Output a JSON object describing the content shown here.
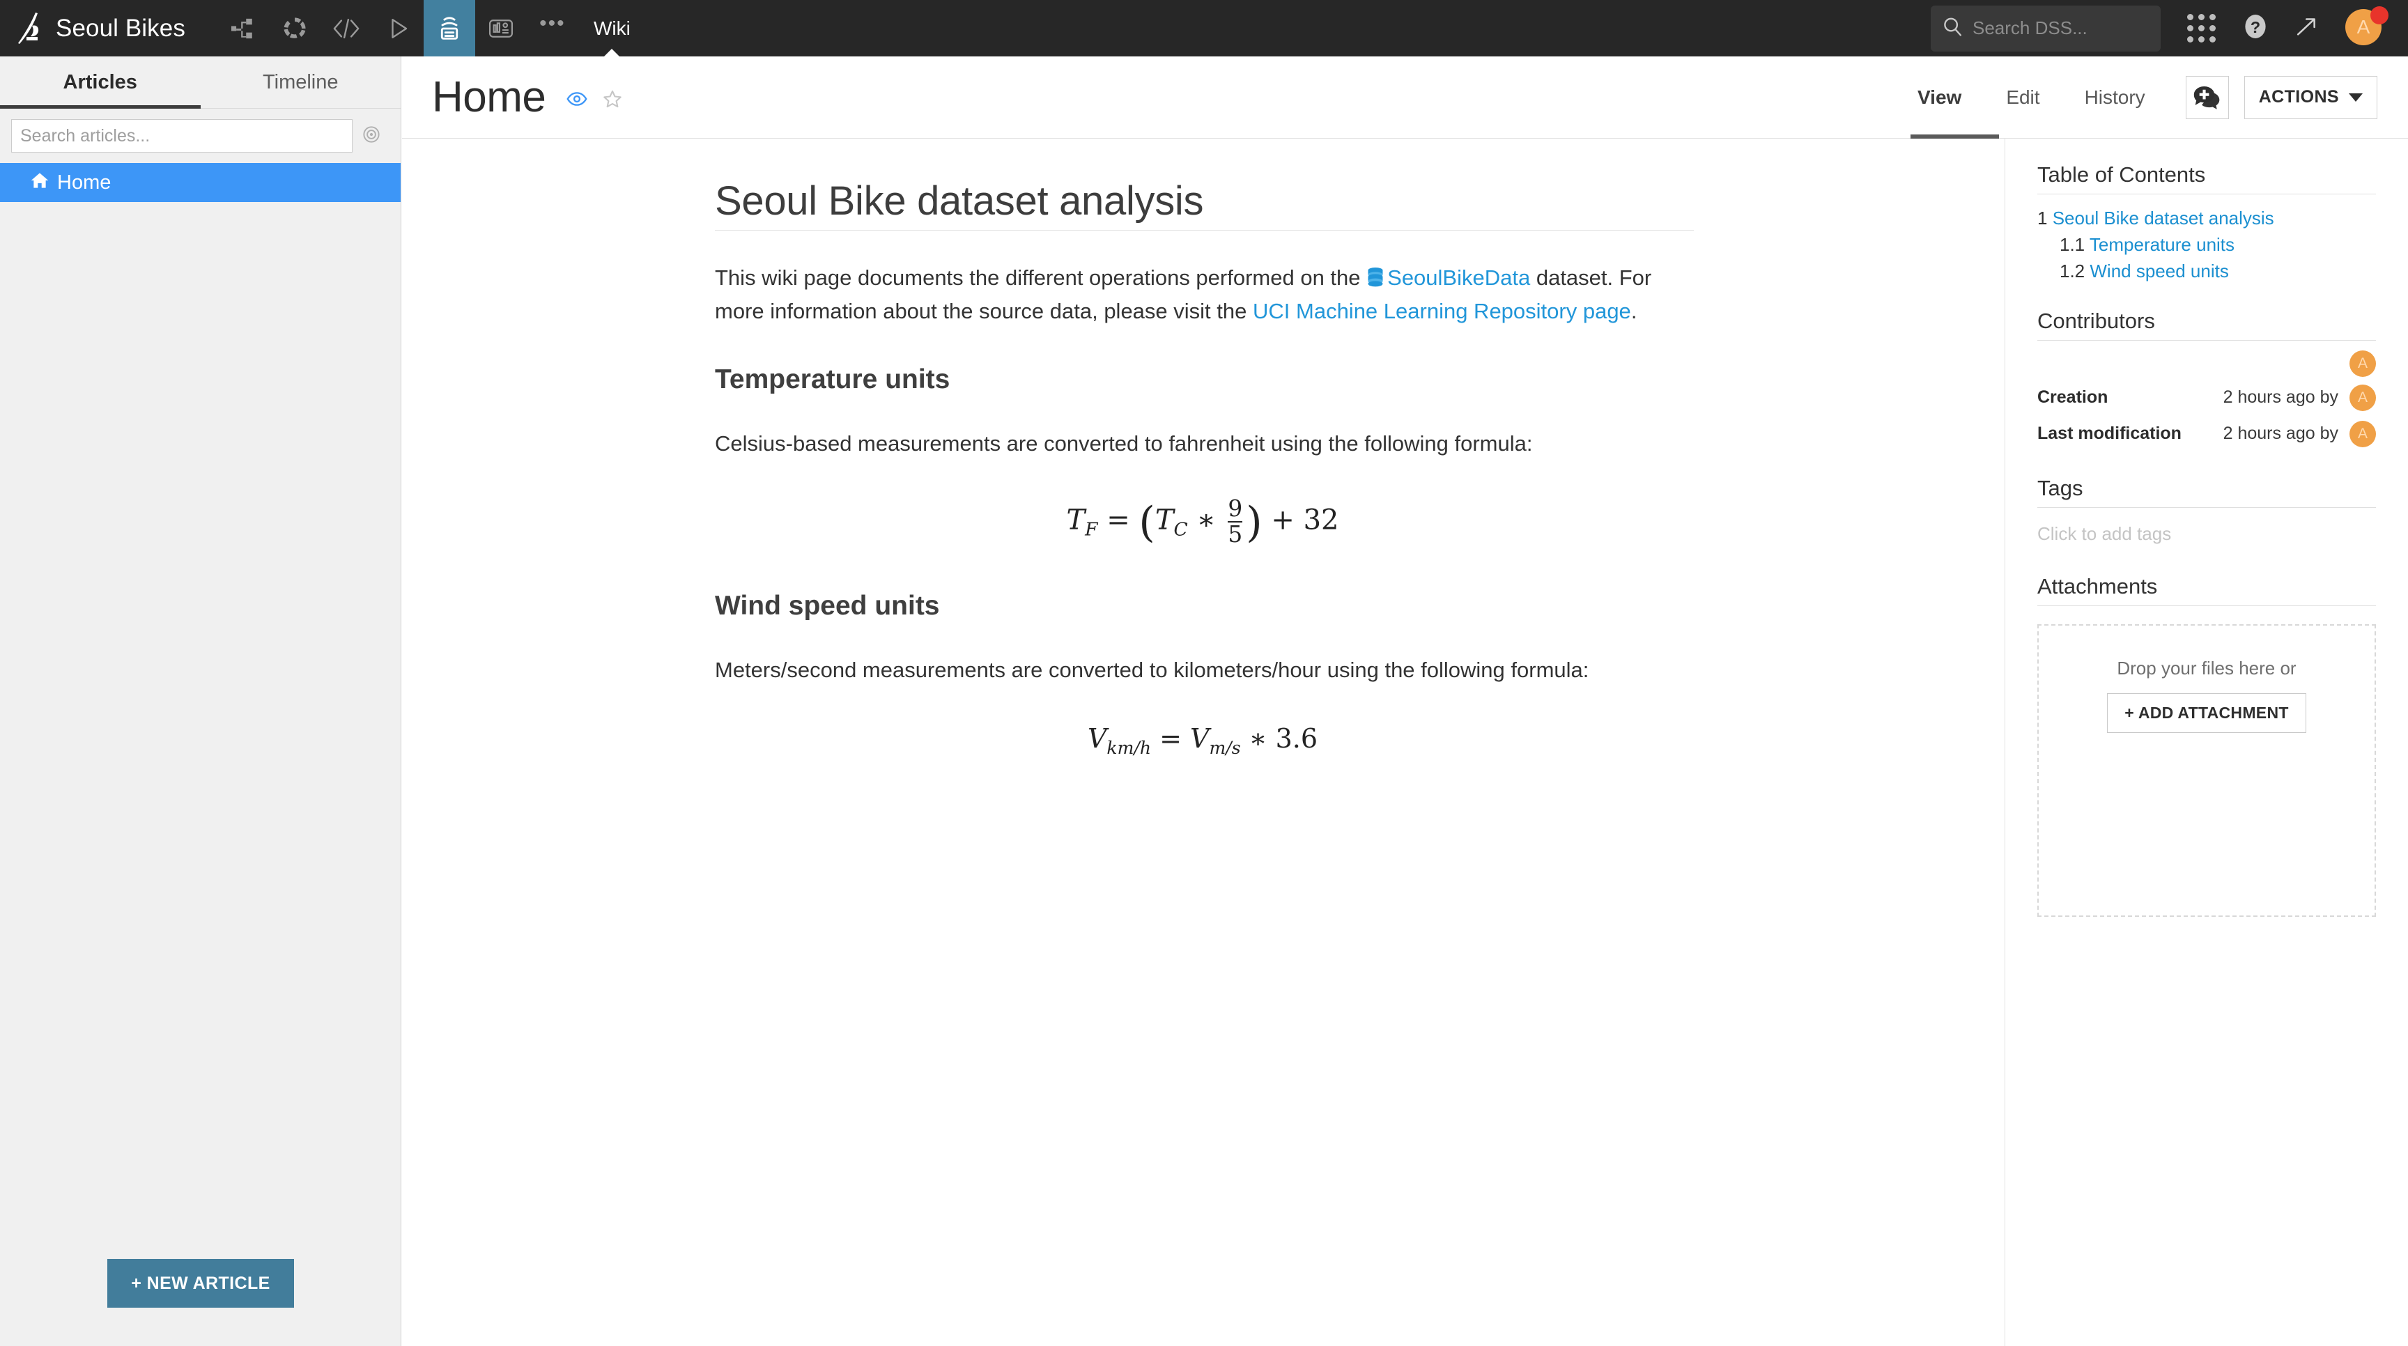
{
  "topnav": {
    "brand": "Seoul Bikes",
    "icons": [
      {
        "name": "flow-icon",
        "label": "Flow"
      },
      {
        "name": "lab-icon",
        "label": "Lab"
      },
      {
        "name": "code-icon",
        "label": "Code"
      },
      {
        "name": "automation-icon",
        "label": "Automation"
      },
      {
        "name": "wiki-icon",
        "label": "Wiki"
      },
      {
        "name": "dashboard-icon",
        "label": "Dashboards"
      },
      {
        "name": "more-icon",
        "label": "More"
      }
    ],
    "active_section": "Wiki",
    "search": {
      "placeholder": "Search DSS...",
      "value": "",
      "icon": "search-icon"
    },
    "apps_icon": "apps-grid-icon",
    "help_icon": "help-icon",
    "trend_icon": "trend-up-icon",
    "avatar_initial": "A",
    "notification_color": "#e8342b",
    "active_icon_color": "#42809f",
    "bar_color": "#272727"
  },
  "sidebar": {
    "tabs": [
      {
        "label": "Articles",
        "active": true
      },
      {
        "label": "Timeline",
        "active": false
      }
    ],
    "search": {
      "placeholder": "Search articles...",
      "value": ""
    },
    "target_icon": "target-icon",
    "articles": [
      {
        "label": "Home",
        "icon": "home-icon",
        "selected": true
      }
    ],
    "new_article_label": "+ NEW ARTICLE",
    "selected_color": "#3d96f7",
    "button_color": "#427d9b"
  },
  "page_header": {
    "title": "Home",
    "watch_icon": "eye-icon",
    "star_icon": "star-icon",
    "tabs": [
      {
        "label": "View",
        "active": true
      },
      {
        "label": "Edit",
        "active": false
      },
      {
        "label": "History",
        "active": false
      }
    ],
    "discussion_icon": "comment-add-icon",
    "actions_label": "ACTIONS",
    "actions_caret": "chevron-down-icon"
  },
  "article": {
    "heading": "Seoul Bike dataset analysis",
    "intro": {
      "before_link": "This wiki page documents the different operations performed on the ",
      "dataset_icon": "dataset-icon",
      "dataset_link": "SeoulBikeData",
      "middle": " dataset. For more information about the source data, please visit the ",
      "repo_link": "UCI Machine Learning Repository page",
      "after_link": "."
    },
    "sections": [
      {
        "heading": "Temperature units",
        "text": "Celsius-based measurements are converted to fahrenheit using the following formula:",
        "formula": {
          "lhs_var": "T",
          "lhs_sub": "F",
          "eq": "=",
          "open": "(",
          "rhs_var": "T",
          "rhs_sub": "C",
          "op": "∗",
          "num": "9",
          "den": "5",
          "close": ")",
          "plus": "+ 32",
          "plain": "T_F = (T_C * 9/5) + 32"
        }
      },
      {
        "heading": "Wind speed units",
        "text": "Meters/second measurements are converted to kilometers/hour using the following formula:",
        "formula": {
          "lhs_var": "V",
          "lhs_sub": "km/h",
          "eq": "=",
          "rhs_var": "V",
          "rhs_sub": "m/s",
          "op": "∗",
          "factor": "3.6",
          "plain": "V_km/h = V_m/s * 3.6"
        }
      }
    ],
    "link_color": "#2196d9"
  },
  "rightbar": {
    "toc_title": "Table of Contents",
    "toc": [
      {
        "number": "1",
        "label": "Seoul Bike dataset analysis",
        "level": 1
      },
      {
        "number": "1.1",
        "label": "Temperature units",
        "level": 2
      },
      {
        "number": "1.2",
        "label": "Wind speed units",
        "level": 2
      }
    ],
    "contributors_title": "Contributors",
    "contributors": [
      {
        "initial": "A"
      }
    ],
    "meta": [
      {
        "label": "Creation",
        "value": "2 hours ago by",
        "avatar": "A"
      },
      {
        "label": "Last modification",
        "value": "2 hours ago by",
        "avatar": "A"
      }
    ],
    "tags_title": "Tags",
    "tags_placeholder": "Click to add tags",
    "attachments_title": "Attachments",
    "dropzone_text": "Drop your files here or",
    "add_attachment_label": "+ ADD ATTACHMENT",
    "toc_link_color": "#1b8fd0",
    "avatar_color": "#f0a046"
  }
}
